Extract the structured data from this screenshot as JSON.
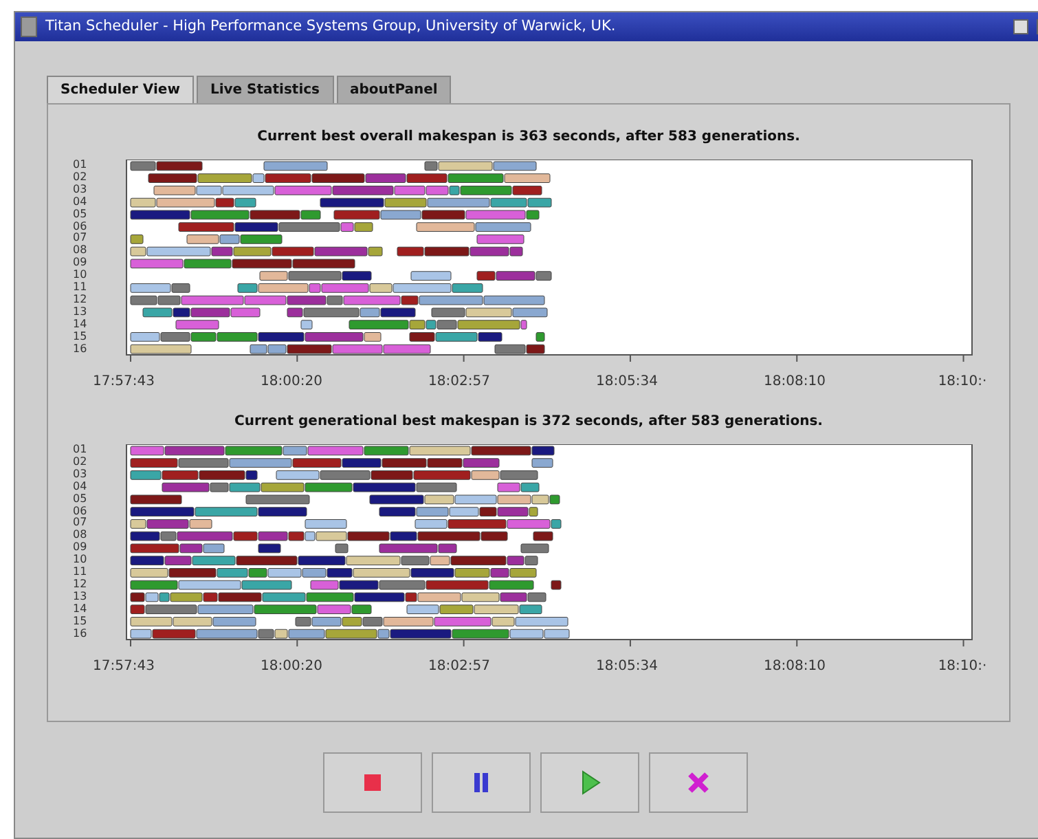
{
  "window": {
    "title": "Titan Scheduler - High Performance Systems Group, University of Warwick, UK."
  },
  "tabs": [
    {
      "label": "Scheduler View",
      "selected": true
    },
    {
      "label": "Live Statistics",
      "selected": false
    },
    {
      "label": "aboutPanel",
      "selected": false
    }
  ],
  "charts": [
    {
      "title": "Current best overall makespan is 363 seconds, after 583 generations.",
      "y_labels": [
        "01",
        "02",
        "03",
        "04",
        "05",
        "06",
        "07",
        "08",
        "09",
        "10",
        "11",
        "12",
        "13",
        "14",
        "15",
        "16"
      ],
      "x_labels": [
        "17:57:43",
        "18:00:20",
        "18:02:57",
        "18:05:34",
        "18:08:10",
        "18:10:·"
      ]
    },
    {
      "title": "Current generational best makespan is 372 seconds, after 583 generations.",
      "y_labels": [
        "01",
        "02",
        "03",
        "04",
        "05",
        "06",
        "07",
        "08",
        "09",
        "10",
        "11",
        "12",
        "13",
        "14",
        "15",
        "16"
      ],
      "x_labels": [
        "17:57:43",
        "18:00:20",
        "18:02:57",
        "18:05:34",
        "18:08:10",
        "18:10:·"
      ]
    }
  ],
  "buttons": [
    {
      "kind": "stop"
    },
    {
      "kind": "pause"
    },
    {
      "kind": "play"
    },
    {
      "kind": "cancel"
    }
  ]
}
